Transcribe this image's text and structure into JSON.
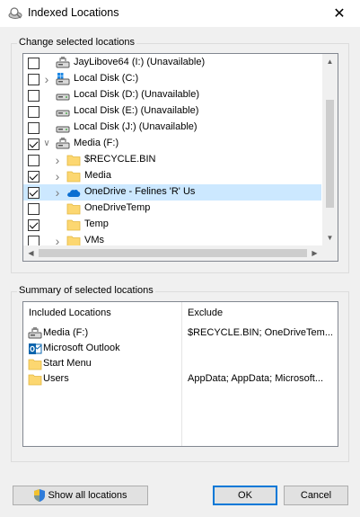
{
  "window": {
    "title": "Indexed Locations",
    "close_glyph": "✕"
  },
  "change_group": {
    "label": "Change selected locations",
    "items": [
      {
        "label": "JayLibove64 (I:) (Unavailable)",
        "checked": false,
        "expandable": false,
        "icon": "network-drive-icon",
        "indent": 0
      },
      {
        "label": "Local Disk (C:)",
        "checked": false,
        "expandable": true,
        "icon": "windows-drive-icon",
        "indent": 0
      },
      {
        "label": "Local Disk (D:) (Unavailable)",
        "checked": false,
        "expandable": false,
        "icon": "drive-icon",
        "indent": 0
      },
      {
        "label": "Local Disk (E:) (Unavailable)",
        "checked": false,
        "expandable": false,
        "icon": "drive-icon",
        "indent": 0
      },
      {
        "label": "Local Disk (J:) (Unavailable)",
        "checked": false,
        "expandable": false,
        "icon": "drive-icon",
        "indent": 0
      },
      {
        "label": "Media (F:)",
        "checked": true,
        "expandable": true,
        "expanded": true,
        "icon": "network-drive-icon",
        "indent": 0
      },
      {
        "label": "$RECYCLE.BIN",
        "checked": false,
        "expandable": true,
        "icon": "folder-icon",
        "indent": 1
      },
      {
        "label": "Media",
        "checked": true,
        "expandable": true,
        "icon": "folder-icon",
        "indent": 1
      },
      {
        "label": "OneDrive - Felines 'R' Us",
        "checked": true,
        "expandable": true,
        "icon": "onedrive-cloud-icon",
        "indent": 1,
        "selected": true
      },
      {
        "label": "OneDriveTemp",
        "checked": false,
        "expandable": false,
        "icon": "folder-icon",
        "indent": 1
      },
      {
        "label": "Temp",
        "checked": true,
        "expandable": false,
        "icon": "folder-icon",
        "indent": 1
      },
      {
        "label": "VMs",
        "checked": false,
        "expandable": true,
        "icon": "folder-icon",
        "indent": 1
      }
    ]
  },
  "summary_group": {
    "label": "Summary of selected locations",
    "col_included": "Included Locations",
    "col_exclude": "Exclude",
    "rows": [
      {
        "name": "Media (F:)",
        "exclude": "$RECYCLE.BIN; OneDriveTem...",
        "icon": "network-drive-icon"
      },
      {
        "name": "Microsoft Outlook",
        "exclude": "",
        "icon": "outlook-icon"
      },
      {
        "name": "Start Menu",
        "exclude": "",
        "icon": "folder-icon"
      },
      {
        "name": "Users",
        "exclude": "AppData; AppData; Microsoft...",
        "icon": "folder-icon"
      }
    ]
  },
  "buttons": {
    "show_all": "Show all locations",
    "ok": "OK",
    "cancel": "Cancel"
  },
  "colors": {
    "selection": "#cce8ff",
    "default_button_border": "#0078d7",
    "folder": "#fcd771",
    "onedrive": "#0a6ed1"
  }
}
